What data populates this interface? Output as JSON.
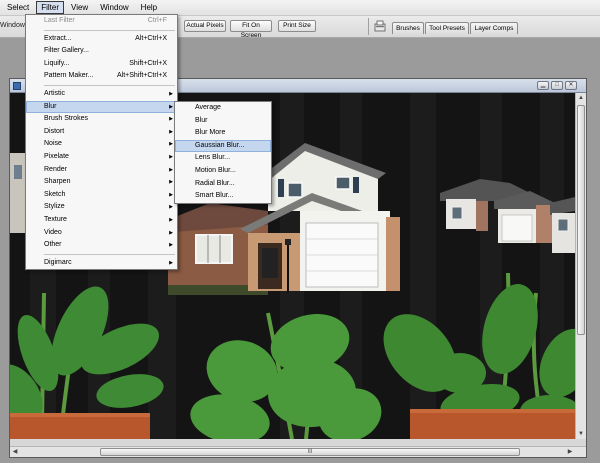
{
  "menubar": {
    "items": [
      "Select",
      "Filter",
      "View",
      "Window",
      "Help"
    ],
    "active": "Filter"
  },
  "options_bar": {
    "truncated_text": "Window",
    "actual_pixels": "Actual Pixels",
    "fit_on_screen": "Fit On Screen",
    "print_size": "Print Size",
    "workspace_icon": "workspace-icon",
    "panel_tabs": [
      "Brushes",
      "Tool Presets",
      "Layer Comps"
    ]
  },
  "filter_menu": {
    "top": [
      {
        "label": "Last Filter",
        "shortcut": "Ctrl+F",
        "disabled": true
      }
    ],
    "group2": [
      {
        "label": "Extract...",
        "shortcut": "Alt+Ctrl+X"
      },
      {
        "label": "Filter Gallery..."
      },
      {
        "label": "Liquify...",
        "shortcut": "Shift+Ctrl+X"
      },
      {
        "label": "Pattern Maker...",
        "shortcut": "Alt+Shift+Ctrl+X"
      }
    ],
    "group3": [
      {
        "label": "Artistic"
      },
      {
        "label": "Blur"
      },
      {
        "label": "Brush Strokes"
      },
      {
        "label": "Distort"
      },
      {
        "label": "Noise"
      },
      {
        "label": "Pixelate"
      },
      {
        "label": "Render"
      },
      {
        "label": "Sharpen"
      },
      {
        "label": "Sketch"
      },
      {
        "label": "Stylize"
      },
      {
        "label": "Texture"
      },
      {
        "label": "Video"
      },
      {
        "label": "Other"
      }
    ],
    "group4": [
      {
        "label": "Digimarc"
      }
    ],
    "highlighted": "Blur"
  },
  "blur_menu": {
    "items": [
      "Average",
      "Blur",
      "Blur More",
      "Gaussian Blur...",
      "Lens Blur...",
      "Motion Blur...",
      "Radial Blur...",
      "Smart Blur..."
    ],
    "highlighted": "Gaussian Blur..."
  },
  "document": {
    "icon": "photoshop-document-icon",
    "window_buttons": [
      "minimize",
      "maximize",
      "close"
    ],
    "scroll_grip": "III"
  },
  "colors": {
    "menu_highlight": "#c5d7ee",
    "titlebar": "#c8d2e2",
    "workspace": "#9b9b9b",
    "canvas_background": "#161616",
    "leaf_green": "#3f8a34",
    "pot_orange": "#b8572c"
  }
}
